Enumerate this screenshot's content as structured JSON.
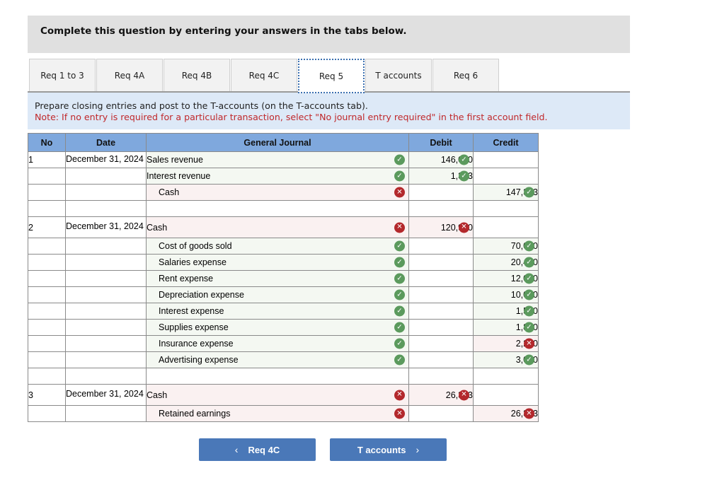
{
  "header": {
    "instruction": "Complete this question by entering your answers in the tabs below."
  },
  "tabs": [
    {
      "label": "Req 1 to 3",
      "active": false
    },
    {
      "label": "Req 4A",
      "active": false
    },
    {
      "label": "Req 4B",
      "active": false
    },
    {
      "label": "Req 4C",
      "active": false
    },
    {
      "label": "Req 5",
      "active": true
    },
    {
      "label": "T accounts",
      "active": false
    },
    {
      "label": "Req 6",
      "active": false
    }
  ],
  "prompt": {
    "text": "Prepare closing entries and post to the T-accounts (on the T-accounts tab).",
    "note": "Note: If no entry is required for a particular transaction, select \"No journal entry required\" in the first account field."
  },
  "table": {
    "headers": {
      "no": "No",
      "date": "Date",
      "journal": "General Journal",
      "debit": "Debit",
      "credit": "Credit"
    },
    "rows": [
      {
        "no": "1",
        "date": "December 31, 2024",
        "account": "Sales revenue",
        "account_status": "check",
        "debit": "146,000",
        "debit_status": "check",
        "credit": "",
        "credit_status": ""
      },
      {
        "no": "",
        "date": "",
        "account": "Interest revenue",
        "account_status": "check",
        "debit": "1,333",
        "debit_status": "check",
        "credit": "",
        "credit_status": ""
      },
      {
        "no": "",
        "date": "",
        "account": "Cash",
        "account_status": "cross",
        "debit": "",
        "debit_status": "",
        "credit": "147,333",
        "credit_status": "check"
      },
      {
        "no": "2",
        "date": "December 31, 2024",
        "account": "Cash",
        "account_status": "cross",
        "debit": "120,950",
        "debit_status": "cross",
        "credit": "",
        "credit_status": ""
      },
      {
        "no": "",
        "date": "",
        "account": "Cost of goods sold",
        "account_status": "check",
        "debit": "",
        "debit_status": "",
        "credit": "70,000",
        "credit_status": "check"
      },
      {
        "no": "",
        "date": "",
        "account": "Salaries expense",
        "account_status": "check",
        "debit": "",
        "debit_status": "",
        "credit": "20,400",
        "credit_status": "check"
      },
      {
        "no": "",
        "date": "",
        "account": "Rent expense",
        "account_status": "check",
        "debit": "",
        "debit_status": "",
        "credit": "12,000",
        "credit_status": "check"
      },
      {
        "no": "",
        "date": "",
        "account": "Depreciation expense",
        "account_status": "check",
        "debit": "",
        "debit_status": "",
        "credit": "10,000",
        "credit_status": "check"
      },
      {
        "no": "",
        "date": "",
        "account": "Interest expense",
        "account_status": "check",
        "debit": "",
        "debit_status": "",
        "credit": "1,500",
        "credit_status": "check"
      },
      {
        "no": "",
        "date": "",
        "account": "Supplies expense",
        "account_status": "check",
        "debit": "",
        "debit_status": "",
        "credit": "1,800",
        "credit_status": "check"
      },
      {
        "no": "",
        "date": "",
        "account": "Insurance expense",
        "account_status": "check",
        "debit": "",
        "debit_status": "",
        "credit": "2,250",
        "credit_status": "cross"
      },
      {
        "no": "",
        "date": "",
        "account": "Advertising expense",
        "account_status": "check",
        "debit": "",
        "debit_status": "",
        "credit": "3,000",
        "credit_status": "check"
      },
      {
        "no": "3",
        "date": "December 31, 2024",
        "account": "Cash",
        "account_status": "cross",
        "debit": "26,383",
        "debit_status": "cross",
        "credit": "",
        "credit_status": ""
      },
      {
        "no": "",
        "date": "",
        "account": "Retained earnings",
        "account_status": "cross",
        "debit": "",
        "debit_status": "",
        "credit": "26,383",
        "credit_status": "cross"
      }
    ]
  },
  "nav": {
    "prev_label": "Req 4C",
    "next_label": "T accounts",
    "prev_icon": "chevron-left-icon",
    "next_icon": "chevron-right-icon"
  },
  "colors": {
    "header_blue": "#7fa8dd",
    "button_blue": "#4a78b8",
    "check_green": "#5b9a5d",
    "cross_red": "#b3282c",
    "note_red": "#c0282b"
  }
}
